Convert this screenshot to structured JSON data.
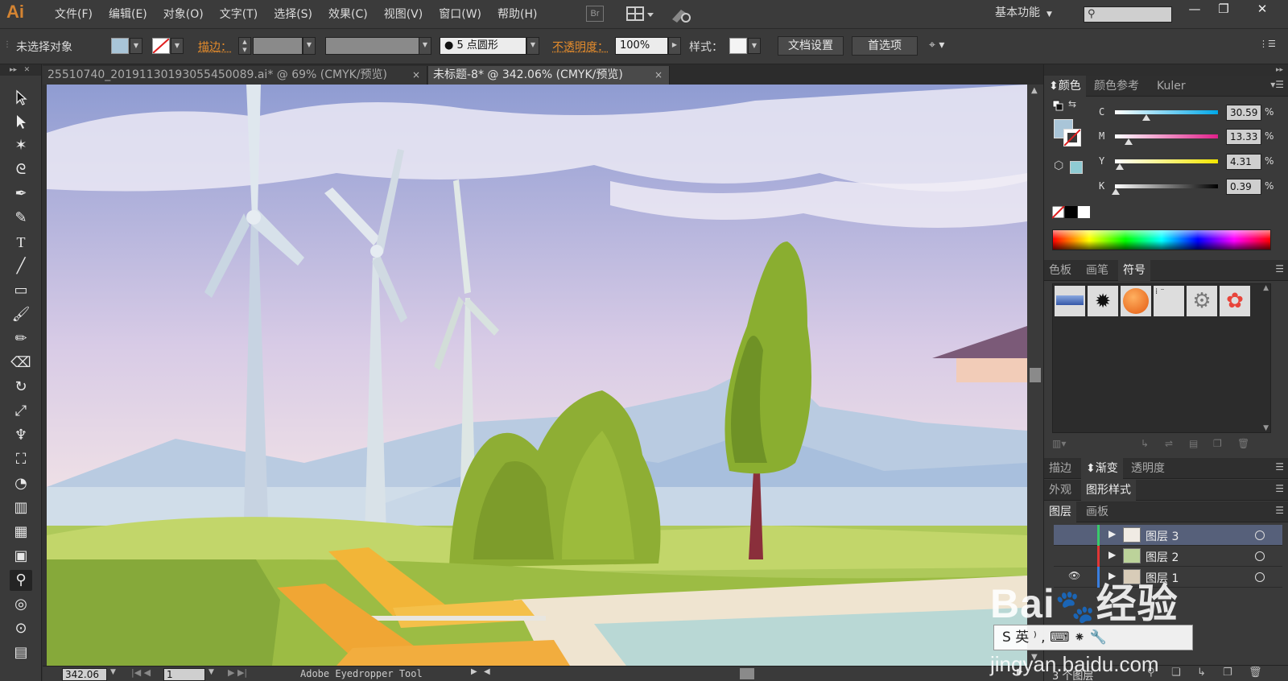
{
  "app": {
    "logo": "Ai",
    "menus": [
      "文件(F)",
      "编辑(E)",
      "对象(O)",
      "文字(T)",
      "选择(S)",
      "效果(C)",
      "视图(V)",
      "窗口(W)",
      "帮助(H)"
    ],
    "bridge_label": "Br",
    "workspace_label": "基本功能",
    "search_placeholder": "",
    "window_controls": [
      "—",
      "❐",
      "✕"
    ]
  },
  "control_bar": {
    "selection_status": "未选择对象",
    "stroke_label": "描边：",
    "brush_label": "5 点圆形",
    "opacity_label": "不透明度：",
    "opacity_value": "100%",
    "style_label": "样式：",
    "doc_setup_button": "文档设置",
    "preferences_button": "首选项"
  },
  "tabs": [
    {
      "title": "25510740_20191130193055450089.ai* @ 69% (CMYK/预览)",
      "close": "×",
      "active": false
    },
    {
      "title": "未标题-8* @ 342.06% (CMYK/预览)",
      "close": "×",
      "active": true
    }
  ],
  "status_bar": {
    "zoom": "342.06",
    "artboard": "1",
    "tool_name": "Adobe Eyedropper Tool"
  },
  "color_panel": {
    "tabs": [
      "颜色",
      "颜色参考",
      "Kuler"
    ],
    "channels": [
      {
        "label": "C",
        "value": "30.59",
        "fraction": 0.306,
        "gradient": "linear-gradient(90deg,#fff,#00a8e8)"
      },
      {
        "label": "M",
        "value": "13.33",
        "fraction": 0.133,
        "gradient": "linear-gradient(90deg,#fff,#e0208a)"
      },
      {
        "label": "Y",
        "value": "4.31",
        "fraction": 0.043,
        "gradient": "linear-gradient(90deg,#fff,#f2e600)"
      },
      {
        "label": "K",
        "value": "0.39",
        "fraction": 0.004,
        "gradient": "linear-gradient(90deg,#fff,#000)"
      }
    ],
    "percent": "%",
    "fill_color": "#a9c5d8",
    "web_color": "#8fcbd3"
  },
  "swatch_panel": {
    "tabs": [
      "色板",
      "画笔",
      "符号"
    ]
  },
  "appearance_tabs_1": [
    "描边",
    "渐变",
    "透明度"
  ],
  "appearance_tabs_2": [
    "外观",
    "图形样式"
  ],
  "layers_panel": {
    "tabs": [
      "图层",
      "画板"
    ],
    "layers": [
      {
        "name": "图层 3",
        "color": "#39c96a"
      },
      {
        "name": "图层 2",
        "color": "#e03636"
      },
      {
        "name": "图层 1",
        "color": "#3a7fe0"
      }
    ],
    "count_label": "3 个图层"
  },
  "watermark": {
    "brand": "Bai",
    "brand_suffix": "经验",
    "url": "jingyan.baidu.com"
  },
  "colors": {
    "accent_orange": "#e38b2c",
    "panel_bg": "#3a3a3a",
    "selection_blue": "#56607a"
  }
}
